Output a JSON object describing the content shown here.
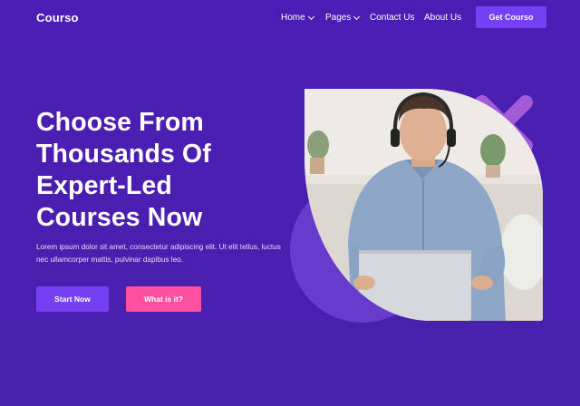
{
  "header": {
    "logo": "Courso",
    "nav": [
      {
        "label": "Home",
        "has_dropdown": true
      },
      {
        "label": "Pages",
        "has_dropdown": true
      },
      {
        "label": "Contact Us",
        "has_dropdown": false
      },
      {
        "label": "About Us",
        "has_dropdown": false
      }
    ],
    "cta_label": "Get Courso"
  },
  "hero": {
    "headline_lines": [
      "Choose From",
      "Thousands Of",
      "Expert-Led",
      "Courses Now"
    ],
    "description": "Lorem ipsum dolor sit amet, consectetur adipiscing elit. Ut elit tellus, luctus nec ullamcorper mattis, pulvinar dapibus leo.",
    "primary_button": "Start Now",
    "secondary_button": "What is it?"
  },
  "colors": {
    "background": "#4a1fb0",
    "accent": "#7540f2",
    "pink": "#ff4fa0",
    "deco_x": "#a45ad8"
  },
  "image": {
    "icon": "man-with-headset-laptop-photo"
  }
}
